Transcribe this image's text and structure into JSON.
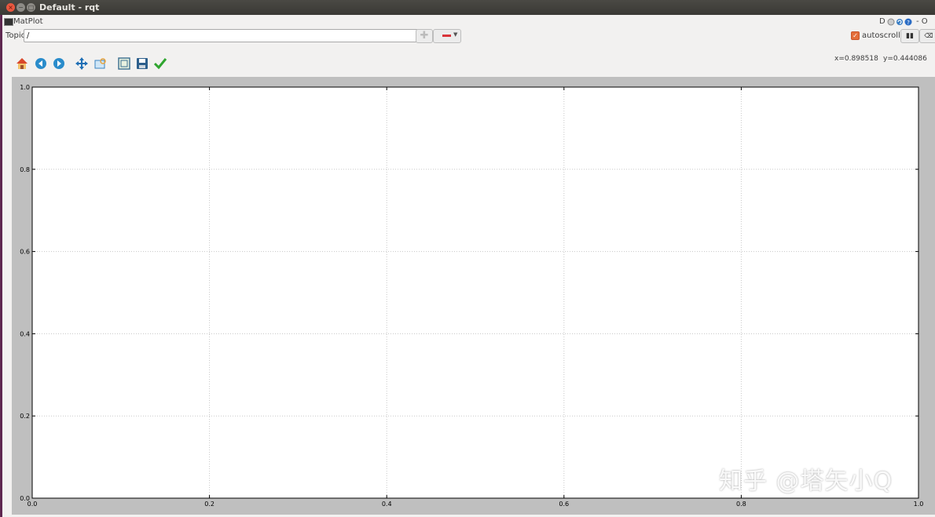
{
  "window": {
    "title": "Default - rqt"
  },
  "plugin": {
    "title": "MatPlot",
    "dock_label": "D",
    "dock_extras": "- O"
  },
  "topic": {
    "label": "Topic",
    "value": "/"
  },
  "autoscroll": {
    "label": "autoscroll",
    "checked": true,
    "accent": "#e46e3a"
  },
  "toolbar": {
    "tools": [
      "home-icon",
      "back-icon",
      "forward-icon",
      "pan-icon",
      "zoom-icon",
      "subplots-icon",
      "save-icon",
      "edit-curves-icon"
    ]
  },
  "coords": {
    "x": "x=0.898518",
    "y": "y=0.444086"
  },
  "chart_data": {
    "type": "line",
    "series": [],
    "xlim": [
      0.0,
      1.0
    ],
    "ylim": [
      0.0,
      1.0
    ],
    "xticks": [
      "0.0",
      "0.2",
      "0.4",
      "0.6",
      "0.8",
      "1.0"
    ],
    "yticks": [
      "0.0",
      "0.2",
      "0.4",
      "0.6",
      "0.8",
      "1.0"
    ],
    "grid": true
  },
  "watermark": "知乎 @塔矢小Q"
}
